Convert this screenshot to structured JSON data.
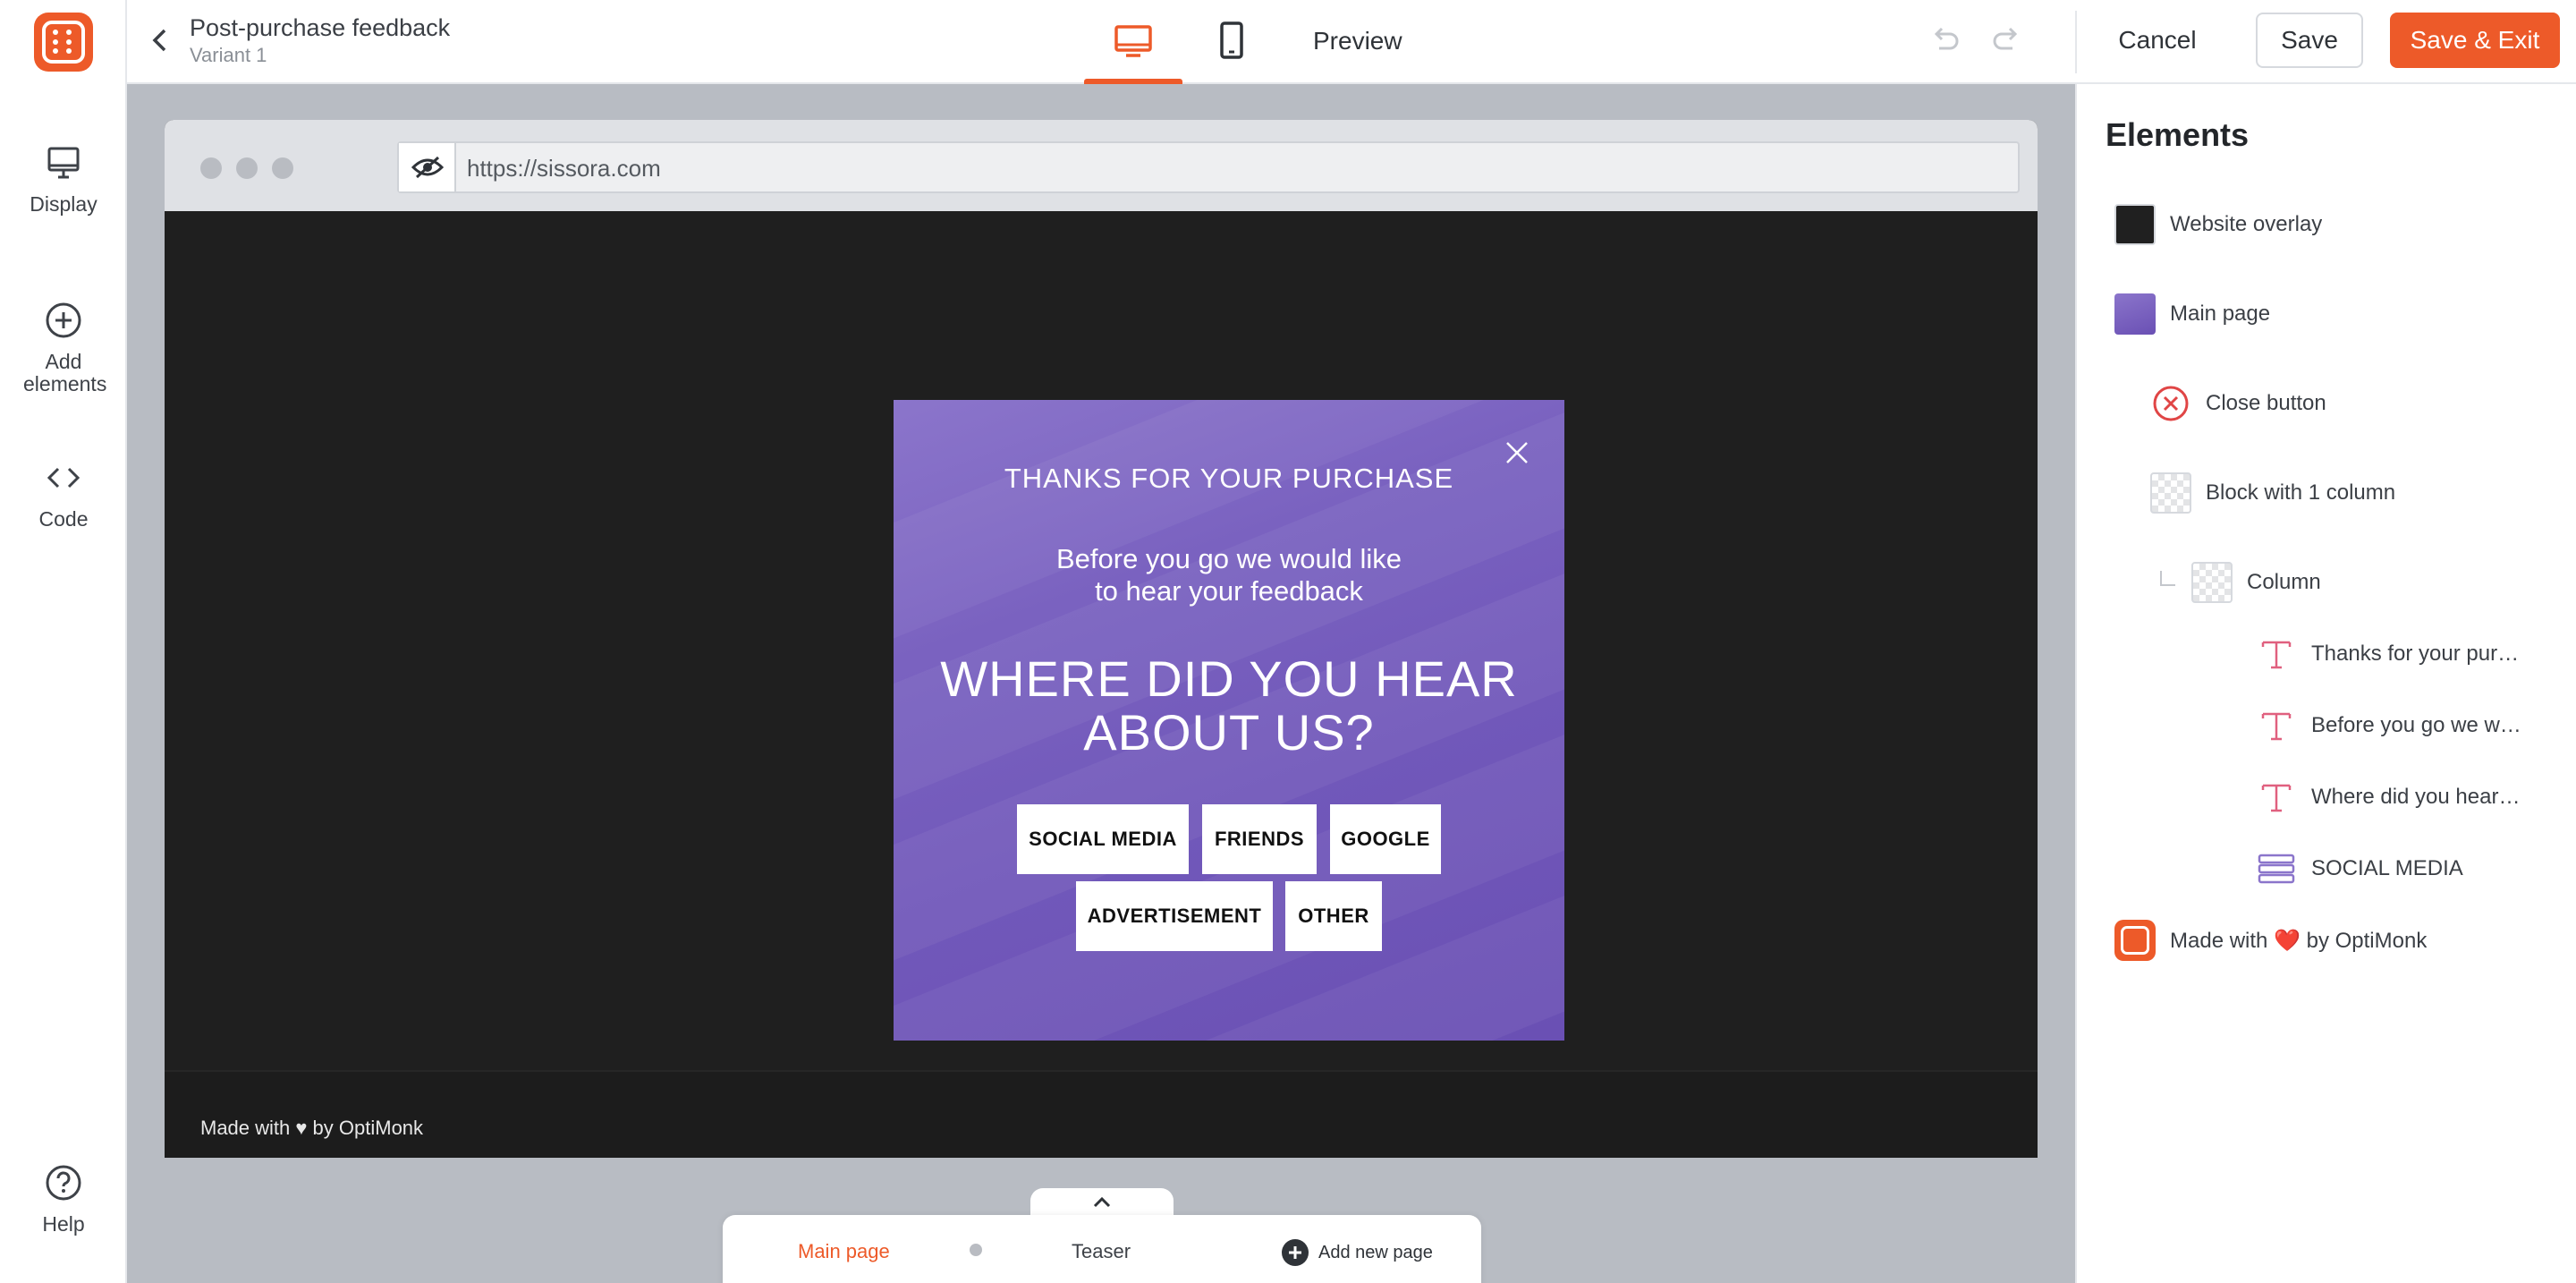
{
  "header": {
    "title": "Post-purchase feedback",
    "subtitle": "Variant 1",
    "preview_label": "Preview",
    "cancel_label": "Cancel",
    "save_label": "Save",
    "save_exit_label": "Save & Exit"
  },
  "left_rail": {
    "items": [
      {
        "label": "Display",
        "icon": "monitor-icon"
      },
      {
        "label": "Add elements",
        "icon": "plus-circle-icon"
      },
      {
        "label": "Code",
        "icon": "code-icon"
      },
      {
        "label": "Help",
        "icon": "help-icon"
      }
    ]
  },
  "browser": {
    "url": "https://sissora.com",
    "footer_text": "Made with ♥ by OptiMonk"
  },
  "popup": {
    "heading_small": "THANKS FOR YOUR PURCHASE",
    "subheading_line1": "Before you go we would like",
    "subheading_line2": "to hear your feedback",
    "question_line1": "WHERE DID YOU HEAR",
    "question_line2": "ABOUT US?",
    "options": [
      "SOCIAL MEDIA",
      "FRIENDS",
      "GOOGLE",
      "ADVERTISEMENT",
      "OTHER"
    ],
    "background_color": "#7a62c0"
  },
  "page_tabs": {
    "main": "Main page",
    "teaser": "Teaser",
    "add": "Add new page"
  },
  "elements_panel": {
    "title": "Elements",
    "items": [
      {
        "label": "Website overlay",
        "icon": "overlay-swatch"
      },
      {
        "label": "Main page",
        "icon": "page-swatch"
      },
      {
        "label": "Close button",
        "icon": "close-circle-icon"
      },
      {
        "label": "Block with 1 column",
        "icon": "block-icon"
      },
      {
        "label": "Column",
        "icon": "column-icon"
      },
      {
        "label": "Thanks for your purc...",
        "icon": "text-icon"
      },
      {
        "label": "Before you go we wo...",
        "icon": "text-icon"
      },
      {
        "label": "Where did you hear a...",
        "icon": "text-icon"
      },
      {
        "label": "SOCIAL MEDIA",
        "icon": "button-group-icon"
      },
      {
        "label": "Made with ❤️ by OptiMonk",
        "icon": "optimonk-logo-icon"
      }
    ]
  },
  "colors": {
    "accent": "#ed5a29",
    "canvas_bg": "#b8bcc3",
    "site_bg": "#1f1f1f"
  }
}
